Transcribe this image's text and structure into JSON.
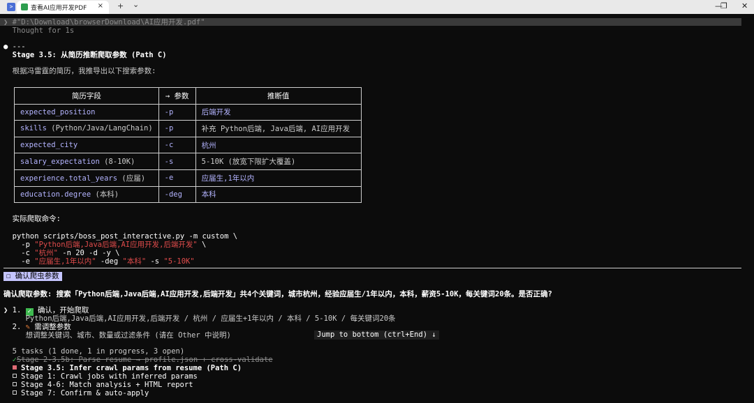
{
  "window": {
    "tab_title": "查看AI应用开发PDF",
    "tab_close": "×",
    "new_tab": "+",
    "dropdown": "⌄",
    "minimize": "—",
    "maximize": "❐",
    "close": "✕"
  },
  "terminal": {
    "prompt_line": "❯ #\"D:\\Download\\browserDownload\\AI应用开发.pdf\"",
    "thought": "  Thought for 1s",
    "bullet_sep": "● ---",
    "stage_title": "  Stage 3.5: 从简历推断爬取参数 (Path C)",
    "intro": "  根据冯雷霆的简历，我推导出以下搜索参数:",
    "table": {
      "headers": [
        "简历字段",
        "→ 参数",
        "推断值"
      ],
      "rows": [
        {
          "field": "expected_position",
          "field_note": "",
          "param": "-p",
          "value": "后端开发"
        },
        {
          "field": "skills",
          "field_note": " (Python/Java/LangChain)",
          "param": "-p",
          "value": "补充 Python后端, Java后端, AI应用开发"
        },
        {
          "field": "expected_city",
          "field_note": "",
          "param": "-c",
          "value": "杭州"
        },
        {
          "field": "salary_expectation",
          "field_note": " (8-10K)",
          "param": "-s",
          "value": "5-10K (放宽下限扩大覆盖)"
        },
        {
          "field": "experience.total_years",
          "field_note": " (应届)",
          "param": "-e",
          "value": "应届生,1年以内"
        },
        {
          "field": "education.degree",
          "field_note": " (本科)",
          "param": "-deg",
          "value": "本科"
        }
      ]
    },
    "cmd_heading": "  实际爬取命令:",
    "cmd": {
      "l1": "  python scripts/boss_post_interactive.py -m custom \\",
      "l2_a": "    -p ",
      "l2_b": "\"Python后端,Java后端,AI应用开发,后端开发\"",
      "l2_c": " \\",
      "l3_a": "    -c ",
      "l3_b": "\"杭州\"",
      "l3_c": " -n 20 -d -y \\",
      "l4_a": "    -e ",
      "l4_b": "\"应届生,1年以内\"",
      "l4_c": " -deg ",
      "l4_d": "\"本科\"",
      "l4_e": " -s ",
      "l4_f": "\"5-10K\""
    },
    "confirm_tag": "☐ 确认爬虫参数",
    "question": "确认爬取参数: 搜索「Python后端,Java后端,AI应用开发,后端开发」共4个关键词，城市杭州，经验应届生/1年以内，本科，薪资5-10K，每关键词20条。是否正确?",
    "options": [
      {
        "prefix": "❯ 1. ",
        "label": "确认，开始爬取",
        "detail": "     Python后端,Java后端,AI应用开发,后端开发 / 杭州 / 应届生+1年以内 / 本科 / 5-10K / 每关键词20条"
      },
      {
        "prefix": "  2. ",
        "label": "需调整参数",
        "detail": "     想调整关键词、城市、数量或过滤条件 (请在 Other 中说明)"
      }
    ],
    "jump_hint": "Jump to bottom (ctrl+End) ↓",
    "tasks_summary": "  5 tasks (1 done, 1 in progress, 3 open)",
    "tasks": [
      {
        "status": "done",
        "label": "Stage 2-3.5b: Parse resume → profile.json + cross-validate"
      },
      {
        "status": "in_progress",
        "label": "Stage 3.5: Infer crawl params from resume (Path C)"
      },
      {
        "status": "open",
        "label": "Stage 1: Crawl jobs with inferred params"
      },
      {
        "status": "open",
        "label": "Stage 4-6: Match analysis + HTML report"
      },
      {
        "status": "open",
        "label": "Stage 7: Confirm & auto-apply"
      }
    ]
  },
  "colors": {
    "background": "#0c0c0c",
    "accent_red": "#e04b4b",
    "accent_lavender": "#b4b4ff",
    "success_green": "#3fb950"
  }
}
